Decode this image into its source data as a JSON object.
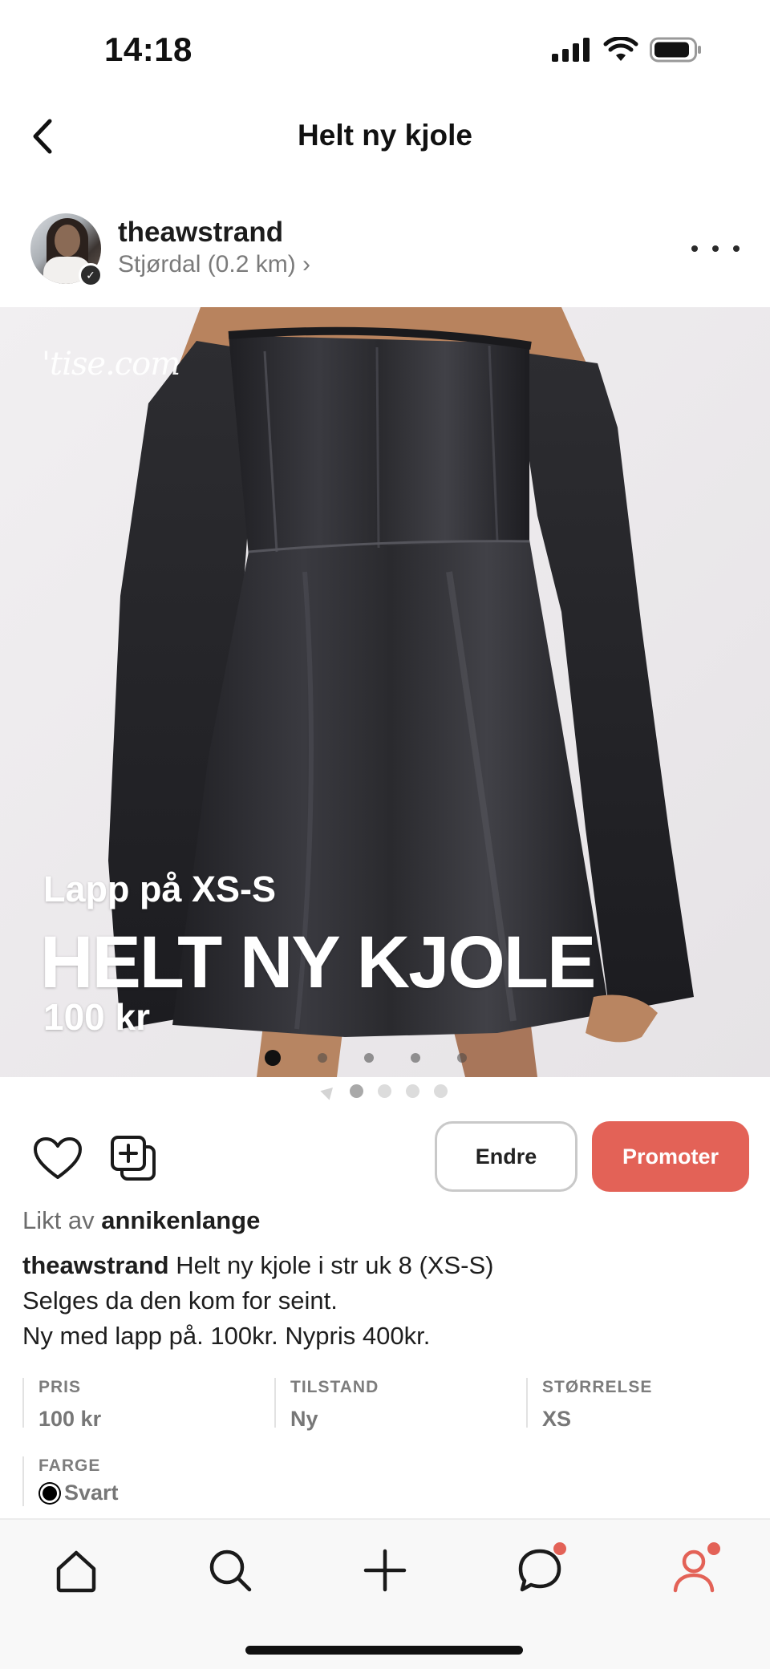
{
  "status": {
    "time": "14:18"
  },
  "nav": {
    "title": "Helt ny kjole"
  },
  "seller": {
    "username": "theawstrand",
    "location": "Stjørdal (0.2 km) ›"
  },
  "listing_image": {
    "watermark": "'tise.com",
    "subtitle": "Lapp på XS-S",
    "title": "HELT NY KJOLE",
    "price": "100 kr",
    "image_count": 5,
    "active_image": 1
  },
  "actions": {
    "edit_label": "Endre",
    "promote_label": "Promoter"
  },
  "liked_by": {
    "prefix": "Likt av",
    "user": "annikenlange"
  },
  "description": {
    "author": "theawstrand",
    "line1": "Helt ny kjole i str uk 8 (XS-S)",
    "line2": "Selges da den kom for seint.",
    "line3": "Ny med lapp på. 100kr. Nypris 400kr."
  },
  "details": {
    "price_label": "PRIS",
    "price_value": "100 kr",
    "condition_label": "TILSTAND",
    "condition_value": "Ny",
    "size_label": "STØRRELSE",
    "size_value": "XS",
    "color_label": "FARGE",
    "color_value": "Svart"
  },
  "tab_bar": {
    "items": [
      "home-icon",
      "search-icon",
      "plus-icon",
      "chat-icon",
      "profile-icon"
    ],
    "accent": "#e36257"
  },
  "colors": {
    "promote": "#e36257",
    "dress": "#2a2a2e"
  }
}
